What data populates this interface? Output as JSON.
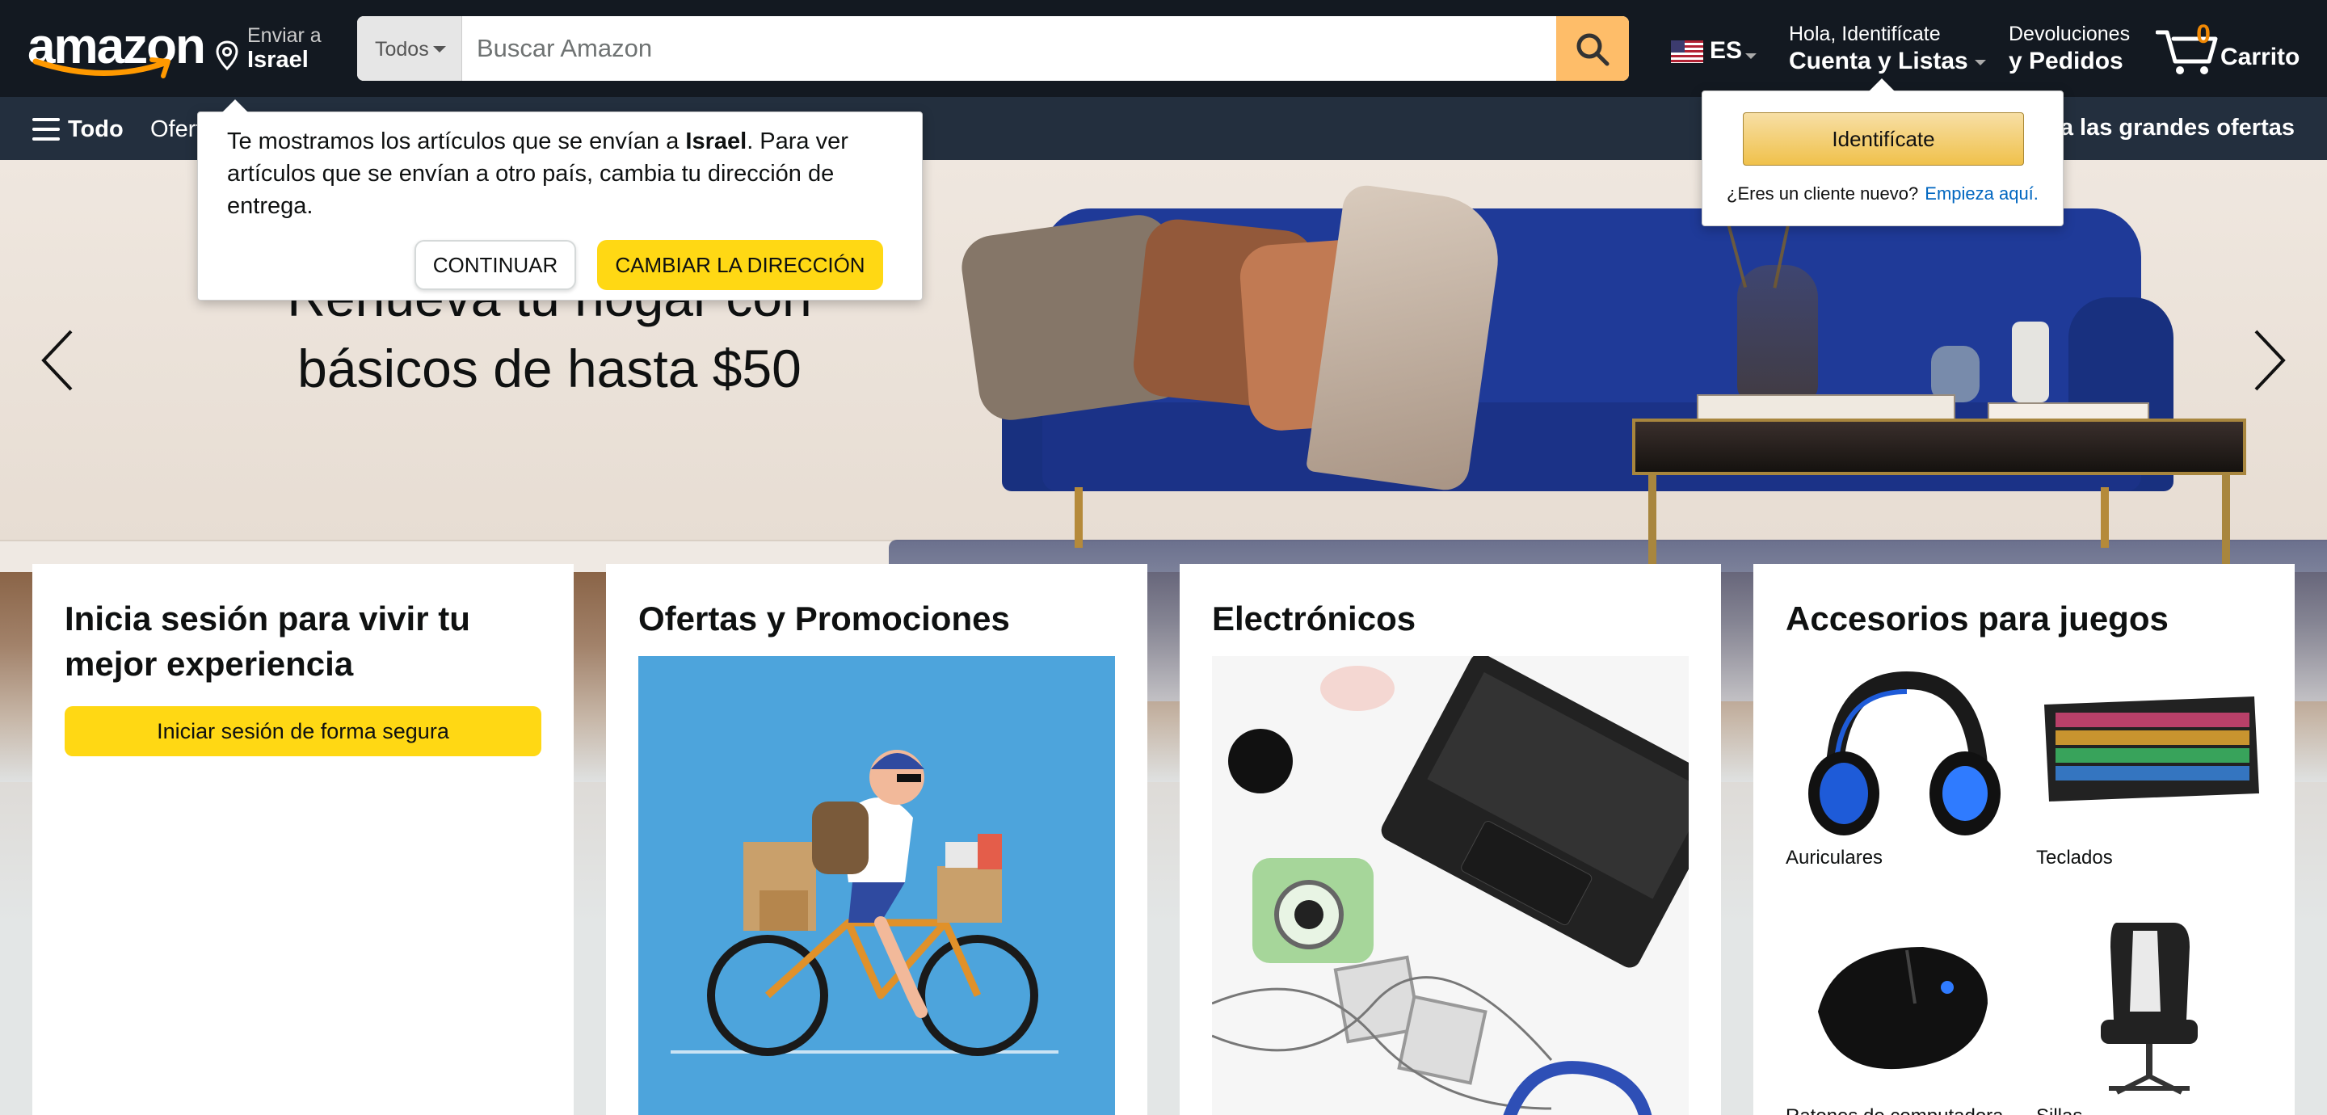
{
  "header": {
    "logo_text": "amazon",
    "deliver_to_label": "Enviar a",
    "deliver_to_country": "Israel",
    "search_category": "Todos",
    "search_placeholder": "Buscar Amazon",
    "language": "ES",
    "account_greeting": "Hola, Identifícate",
    "account_lists": "Cuenta y Listas",
    "returns_line1": "Devoluciones",
    "returns_line2": "y Pedidos",
    "cart_count": "0",
    "cart_label": "Carrito",
    "colors": {
      "nav_bg": "#131921",
      "subnav_bg": "#232f3e",
      "search_button": "#febd69",
      "cart_count": "#f08804"
    }
  },
  "subnav": {
    "all_label": "Todo",
    "first_item": "Ofertas",
    "promo_link": "Descubre ya las grandes ofertas"
  },
  "hero": {
    "line1": "Renueva tu hogar con",
    "line2": "básicos de hasta $50"
  },
  "country_popover": {
    "text_before": "Te mostramos los artículos que se envían a ",
    "country": "Israel",
    "text_after": ". Para ver artículos que se envían a otro país, cambia tu dirección de entrega.",
    "continue_label": "CONTINUAR",
    "change_label": "CAMBIAR LA DIRECCIÓN"
  },
  "signin_popover": {
    "button_label": "Identifícate",
    "new_customer_text": "¿Eres un cliente nuevo?",
    "start_here_link": "Empieza aquí."
  },
  "cards": {
    "signin": {
      "title": "Inicia sesión para vivir tu mejor experiencia",
      "button": "Iniciar sesión de forma segura"
    },
    "deals": {
      "title": "Ofertas y Promociones"
    },
    "electronics": {
      "title": "Electrónicos"
    },
    "gaming": {
      "title": "Accesorios para juegos",
      "items": [
        {
          "label": "Auriculares"
        },
        {
          "label": "Teclados"
        },
        {
          "label": "Ratones de computadora"
        },
        {
          "label": "Sillas"
        }
      ]
    }
  }
}
